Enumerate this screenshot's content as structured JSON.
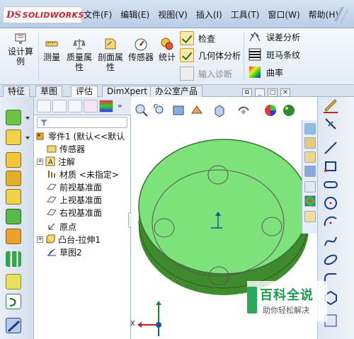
{
  "app": {
    "logo_text": "SOLIDWORKS",
    "logo_mark": "DS"
  },
  "menu": [
    "文件(F)",
    "编辑(E)",
    "视图(V)",
    "插入(I)",
    "工具(T)",
    "窗口(W)",
    "帮助(H)"
  ],
  "ribbon": {
    "design_study_line1": "设计算",
    "design_study_line2": "例",
    "measure": "测量",
    "mass_props_line1": "质量属",
    "mass_props_line2": "性",
    "section_props_line1": "剖面属",
    "section_props_line2": "性",
    "sensor": "传感器",
    "statistics": "统计",
    "check": "检查",
    "geometry_analysis": "几何体分析",
    "import_diagnostics": "输入诊断",
    "deviation_analysis": "误差分析",
    "zebra_stripes": "斑马条纹",
    "curvature": "曲率"
  },
  "tabs": [
    "特征",
    "草图",
    "评估",
    "DimXpert",
    "办公室产品"
  ],
  "active_tab": "评估",
  "feature_tree": {
    "part": "零件1 (默认<<默认",
    "items": [
      "传感器",
      "注解",
      "材质 <未指定>",
      "前视基准面",
      "上视基准面",
      "右视基准面",
      "原点",
      "凸台-拉伸1",
      "草图2"
    ]
  },
  "viewport": {
    "model_color": "#7ee27a",
    "model_side_color": "#3e8a2c",
    "triad_x": "X"
  },
  "watermark": {
    "title": "百科全说",
    "subtitle": "助你轻松解决"
  },
  "colors": {
    "accent_blue": "#1f4e9c",
    "ribbon_bg": "#e3ebf5"
  }
}
